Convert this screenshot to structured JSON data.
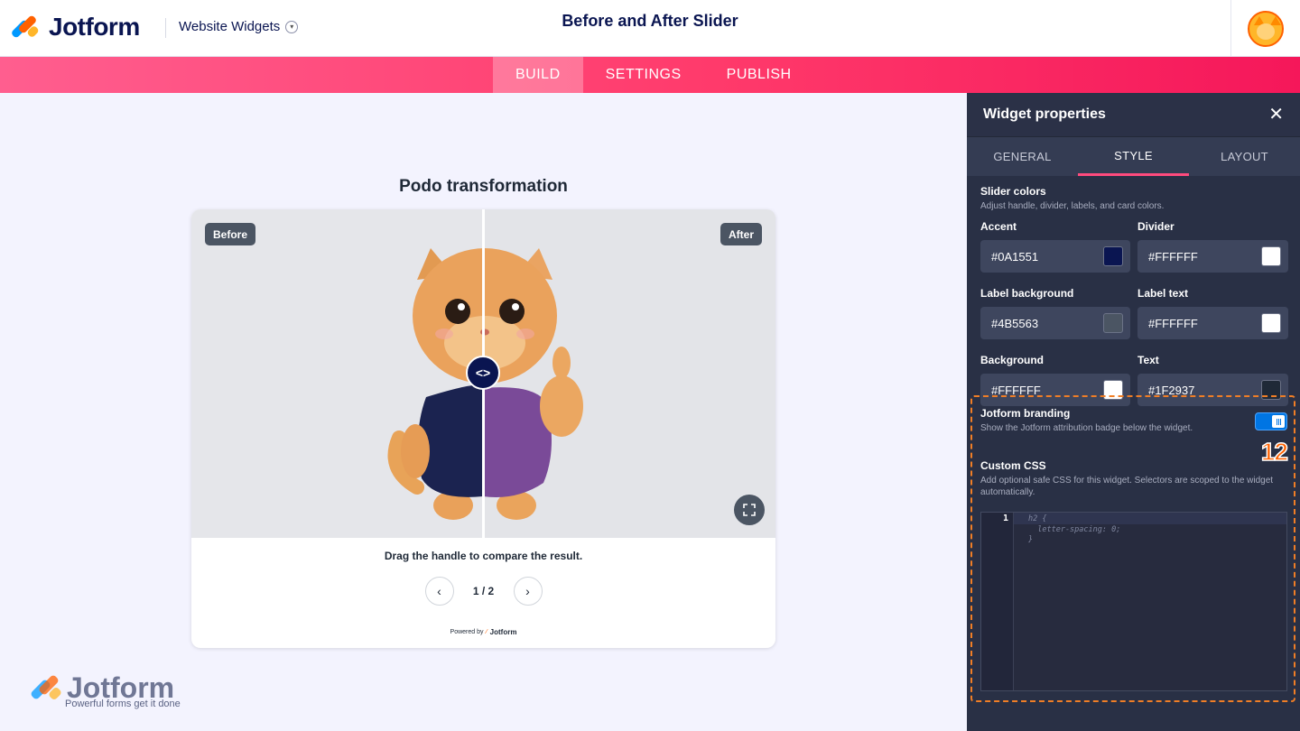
{
  "header": {
    "brand": "Jotform",
    "workspace": "Website Widgets",
    "page_title": "Before and After Slider"
  },
  "nav": {
    "tabs": [
      {
        "label": "BUILD",
        "active": true
      },
      {
        "label": "SETTINGS",
        "active": false
      },
      {
        "label": "PUBLISH",
        "active": false
      }
    ]
  },
  "preview": {
    "title": "Podo transformation",
    "before_label": "Before",
    "after_label": "After",
    "handle_icon": "<>",
    "hint": "Drag the handle to compare the result.",
    "page_counter": "1 / 2",
    "powered_by": "Powered by",
    "powered_brand": "Jotform"
  },
  "watermark": {
    "brand": "Jotform",
    "tagline": "Powerful forms get it done"
  },
  "panel": {
    "title": "Widget properties",
    "tabs": [
      {
        "label": "GENERAL",
        "active": false
      },
      {
        "label": "STYLE",
        "active": true
      },
      {
        "label": "LAYOUT",
        "active": false
      }
    ],
    "slider_colors": {
      "title": "Slider colors",
      "desc": "Adjust handle, divider, labels, and card colors."
    },
    "colors": [
      {
        "label": "Accent",
        "value": "#0A1551",
        "swatch": "#0A1551"
      },
      {
        "label": "Divider",
        "value": "#FFFFFF",
        "swatch": "#FFFFFF"
      },
      {
        "label": "Label background",
        "value": "#4B5563",
        "swatch": "#4B5563"
      },
      {
        "label": "Label text",
        "value": "#FFFFFF",
        "swatch": "#FFFFFF"
      },
      {
        "label": "Background",
        "value": "#FFFFFF",
        "swatch": "#FFFFFF"
      },
      {
        "label": "Text",
        "value": "#1F2937",
        "swatch": "#1F2937"
      }
    ],
    "branding": {
      "title": "Jotform branding",
      "desc": "Show the Jotform attribution badge below the widget.",
      "enabled": true
    },
    "step_badge": "12",
    "custom_css": {
      "title": "Custom CSS",
      "desc": "Add optional safe CSS for this widget. Selectors are scoped to the widget automatically.",
      "line_number": "1",
      "code": "h2 {\n  letter-spacing: 0;\n}"
    }
  },
  "colors": {
    "accent": "#0a1551",
    "nav_gradient_start": "#ff5e8f",
    "nav_gradient_end": "#f5175a",
    "panel_bg": "#293045",
    "highlight": "#f07e26"
  }
}
